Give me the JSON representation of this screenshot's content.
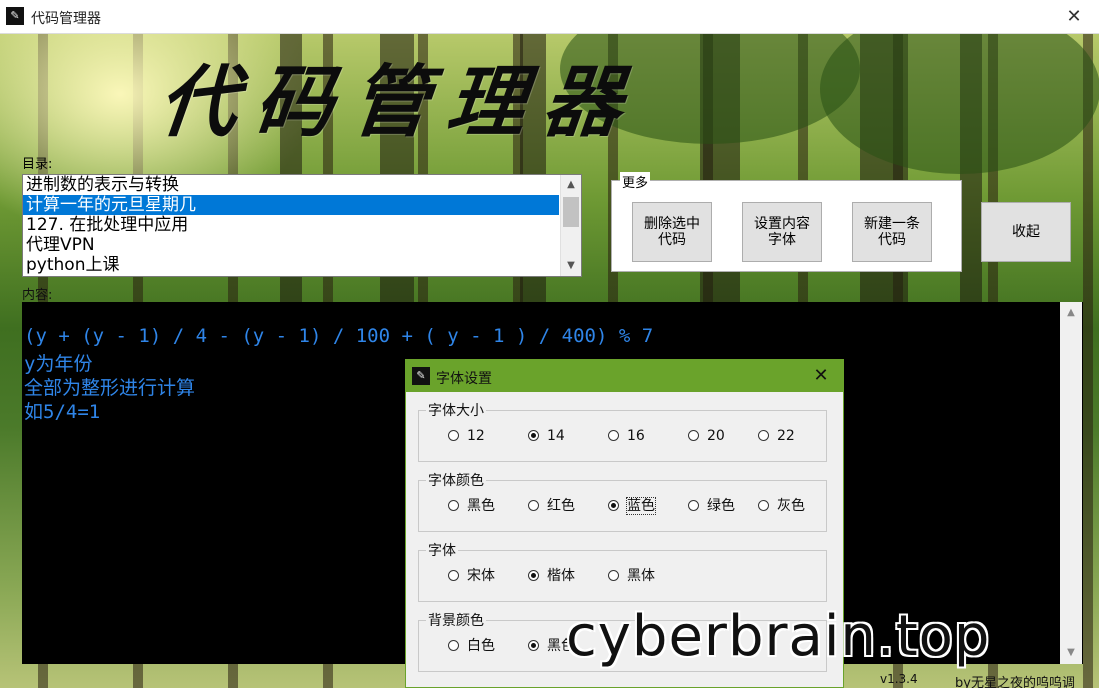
{
  "window": {
    "title": "代码管理器",
    "icon": "feather-pen-icon"
  },
  "header": {
    "big_title": "代码管理器"
  },
  "directory": {
    "label": "目录:",
    "items": [
      "进制数的表示与转换",
      "计算一年的元旦星期几",
      "127. 在批处理中应用",
      "代理VPN",
      "python上课"
    ],
    "selected_index": 1
  },
  "more": {
    "legend": "更多",
    "delete_label": "删除选中\n代码",
    "font_label": "设置内容\n字体",
    "new_label": "新建一条\n代码"
  },
  "collapse_label": "收起",
  "content": {
    "label": "内容:",
    "lines": [
      "(y + (y - 1) / 4 - (y - 1) / 100 + ( y - 1 ) / 400) % 7",
      "y为年份",
      "全部为整形进行计算",
      "如5/4=1"
    ],
    "text_color": "#2f85e8",
    "background": "#000000"
  },
  "footer": {
    "version": "v1.3.4",
    "author": "by无星之夜的呜呜调"
  },
  "dialog": {
    "title": "字体设置",
    "accent": "#6aa32b",
    "groups": [
      {
        "legend": "字体大小",
        "options": [
          "12",
          "14",
          "16",
          "20",
          "22"
        ],
        "selected": 1
      },
      {
        "legend": "字体颜色",
        "options": [
          "黑色",
          "红色",
          "蓝色",
          "绿色",
          "灰色"
        ],
        "selected": 2
      },
      {
        "legend": "字体",
        "options": [
          "宋体",
          "楷体",
          "黑体"
        ],
        "selected": 1
      },
      {
        "legend": "背景颜色",
        "options": [
          "白色",
          "黑色"
        ],
        "selected": 1
      }
    ]
  },
  "watermark": "cyberbrain.top"
}
